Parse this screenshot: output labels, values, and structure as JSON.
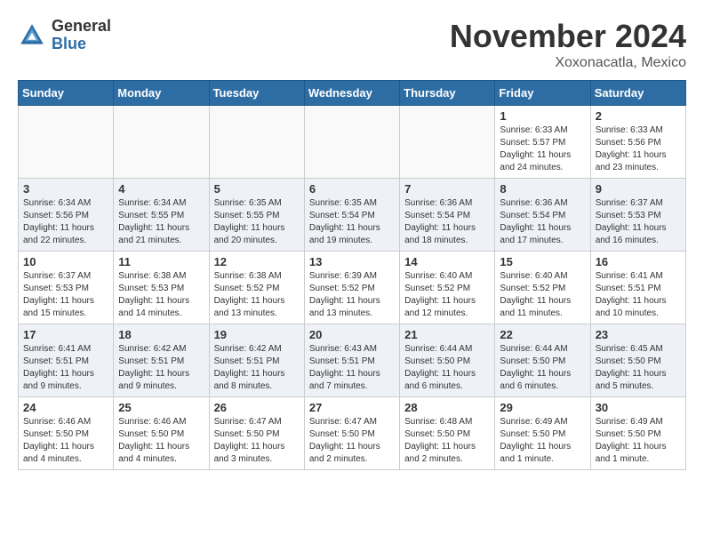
{
  "header": {
    "logo_general": "General",
    "logo_blue": "Blue",
    "month_title": "November 2024",
    "location": "Xoxonacatla, Mexico"
  },
  "weekdays": [
    "Sunday",
    "Monday",
    "Tuesday",
    "Wednesday",
    "Thursday",
    "Friday",
    "Saturday"
  ],
  "weeks": [
    {
      "days": [
        {
          "num": "",
          "info": ""
        },
        {
          "num": "",
          "info": ""
        },
        {
          "num": "",
          "info": ""
        },
        {
          "num": "",
          "info": ""
        },
        {
          "num": "",
          "info": ""
        },
        {
          "num": "1",
          "info": "Sunrise: 6:33 AM\nSunset: 5:57 PM\nDaylight: 11 hours\nand 24 minutes."
        },
        {
          "num": "2",
          "info": "Sunrise: 6:33 AM\nSunset: 5:56 PM\nDaylight: 11 hours\nand 23 minutes."
        }
      ]
    },
    {
      "days": [
        {
          "num": "3",
          "info": "Sunrise: 6:34 AM\nSunset: 5:56 PM\nDaylight: 11 hours\nand 22 minutes."
        },
        {
          "num": "4",
          "info": "Sunrise: 6:34 AM\nSunset: 5:55 PM\nDaylight: 11 hours\nand 21 minutes."
        },
        {
          "num": "5",
          "info": "Sunrise: 6:35 AM\nSunset: 5:55 PM\nDaylight: 11 hours\nand 20 minutes."
        },
        {
          "num": "6",
          "info": "Sunrise: 6:35 AM\nSunset: 5:54 PM\nDaylight: 11 hours\nand 19 minutes."
        },
        {
          "num": "7",
          "info": "Sunrise: 6:36 AM\nSunset: 5:54 PM\nDaylight: 11 hours\nand 18 minutes."
        },
        {
          "num": "8",
          "info": "Sunrise: 6:36 AM\nSunset: 5:54 PM\nDaylight: 11 hours\nand 17 minutes."
        },
        {
          "num": "9",
          "info": "Sunrise: 6:37 AM\nSunset: 5:53 PM\nDaylight: 11 hours\nand 16 minutes."
        }
      ]
    },
    {
      "days": [
        {
          "num": "10",
          "info": "Sunrise: 6:37 AM\nSunset: 5:53 PM\nDaylight: 11 hours\nand 15 minutes."
        },
        {
          "num": "11",
          "info": "Sunrise: 6:38 AM\nSunset: 5:53 PM\nDaylight: 11 hours\nand 14 minutes."
        },
        {
          "num": "12",
          "info": "Sunrise: 6:38 AM\nSunset: 5:52 PM\nDaylight: 11 hours\nand 13 minutes."
        },
        {
          "num": "13",
          "info": "Sunrise: 6:39 AM\nSunset: 5:52 PM\nDaylight: 11 hours\nand 13 minutes."
        },
        {
          "num": "14",
          "info": "Sunrise: 6:40 AM\nSunset: 5:52 PM\nDaylight: 11 hours\nand 12 minutes."
        },
        {
          "num": "15",
          "info": "Sunrise: 6:40 AM\nSunset: 5:52 PM\nDaylight: 11 hours\nand 11 minutes."
        },
        {
          "num": "16",
          "info": "Sunrise: 6:41 AM\nSunset: 5:51 PM\nDaylight: 11 hours\nand 10 minutes."
        }
      ]
    },
    {
      "days": [
        {
          "num": "17",
          "info": "Sunrise: 6:41 AM\nSunset: 5:51 PM\nDaylight: 11 hours\nand 9 minutes."
        },
        {
          "num": "18",
          "info": "Sunrise: 6:42 AM\nSunset: 5:51 PM\nDaylight: 11 hours\nand 9 minutes."
        },
        {
          "num": "19",
          "info": "Sunrise: 6:42 AM\nSunset: 5:51 PM\nDaylight: 11 hours\nand 8 minutes."
        },
        {
          "num": "20",
          "info": "Sunrise: 6:43 AM\nSunset: 5:51 PM\nDaylight: 11 hours\nand 7 minutes."
        },
        {
          "num": "21",
          "info": "Sunrise: 6:44 AM\nSunset: 5:50 PM\nDaylight: 11 hours\nand 6 minutes."
        },
        {
          "num": "22",
          "info": "Sunrise: 6:44 AM\nSunset: 5:50 PM\nDaylight: 11 hours\nand 6 minutes."
        },
        {
          "num": "23",
          "info": "Sunrise: 6:45 AM\nSunset: 5:50 PM\nDaylight: 11 hours\nand 5 minutes."
        }
      ]
    },
    {
      "days": [
        {
          "num": "24",
          "info": "Sunrise: 6:46 AM\nSunset: 5:50 PM\nDaylight: 11 hours\nand 4 minutes."
        },
        {
          "num": "25",
          "info": "Sunrise: 6:46 AM\nSunset: 5:50 PM\nDaylight: 11 hours\nand 4 minutes."
        },
        {
          "num": "26",
          "info": "Sunrise: 6:47 AM\nSunset: 5:50 PM\nDaylight: 11 hours\nand 3 minutes."
        },
        {
          "num": "27",
          "info": "Sunrise: 6:47 AM\nSunset: 5:50 PM\nDaylight: 11 hours\nand 2 minutes."
        },
        {
          "num": "28",
          "info": "Sunrise: 6:48 AM\nSunset: 5:50 PM\nDaylight: 11 hours\nand 2 minutes."
        },
        {
          "num": "29",
          "info": "Sunrise: 6:49 AM\nSunset: 5:50 PM\nDaylight: 11 hours\nand 1 minute."
        },
        {
          "num": "30",
          "info": "Sunrise: 6:49 AM\nSunset: 5:50 PM\nDaylight: 11 hours\nand 1 minute."
        }
      ]
    }
  ]
}
